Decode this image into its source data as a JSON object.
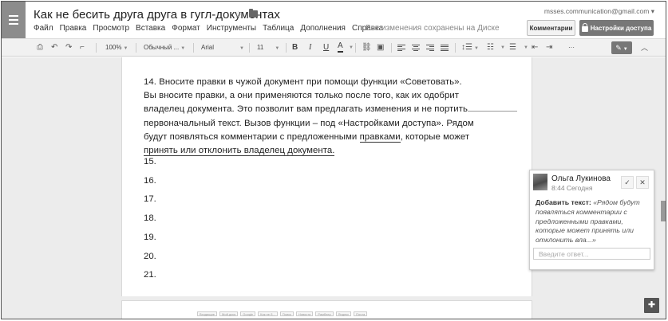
{
  "header": {
    "title": "Как не бесить друга друга в гугл-документах",
    "account": "msses.communication@gmail.com",
    "save_status": "Все изменения сохранены на Диске",
    "comments_label": "Комментарии",
    "share_label": "Настройки доступа",
    "menu": [
      "Файл",
      "Правка",
      "Просмотр",
      "Вставка",
      "Формат",
      "Инструменты",
      "Таблица",
      "Дополнения",
      "Справка"
    ]
  },
  "toolbar": {
    "zoom": "100%",
    "style": "Обычный ...",
    "font": "Arial",
    "size": "11",
    "bold": "B",
    "italic": "I",
    "underline": "U",
    "textcolor": "A",
    "more": "···"
  },
  "document": {
    "lines": [
      "14. Вносите правки в чужой документ при помощи функции «Советовать».",
      "Вы вносите правки, а они применяются только после того, как их одобрит",
      "владелец документа. Это позволит вам предлагать изменения и не портить",
      "первоначальный текст. Вызов функции – под «Настройками доступа». Рядом"
    ],
    "line5_a": "будут появляться комментарии с предложенными ",
    "line5_link": "правками",
    "line5_b": ", которые может",
    "line6": "принять или отклонить владелец документа.",
    "numbers": [
      "15.",
      "16.",
      "17.",
      "18.",
      "19.",
      "20.",
      "21."
    ]
  },
  "comment": {
    "author": "Ольга Лукинова",
    "time": "8:44 Сегодня",
    "action": "Добавить текст:",
    "text": "«Рядом будут появляться комментарии с предложенными правками, которые может принять или отклонить вла...»",
    "reply_placeholder": "Введите ответ..."
  },
  "taskbar": [
    "Входящие",
    "Мой диск",
    "Google",
    "Как не б...",
    "Поиск",
    "Новости",
    "Рамблер",
    "Яндекс",
    "Почта"
  ]
}
